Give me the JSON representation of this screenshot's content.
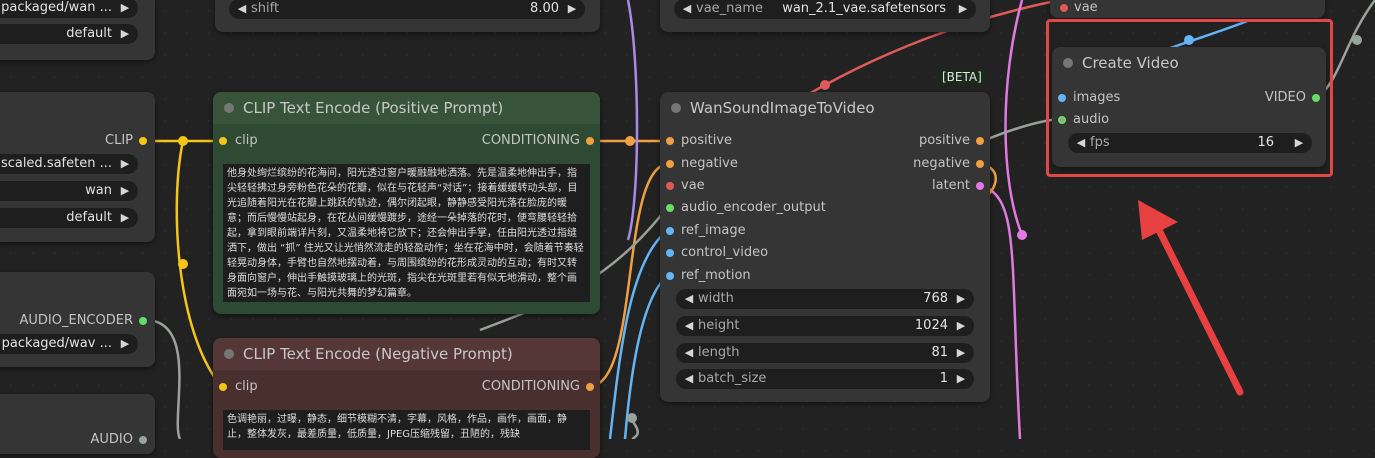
{
  "left_top_node": {
    "widgets": [
      {
        "value": "packaged/wan ..."
      },
      {
        "value": "default"
      }
    ]
  },
  "shift_node": {
    "widget": {
      "label": "shift",
      "value": "8.00"
    }
  },
  "vae_loader": {
    "widget": {
      "label": "vae_name",
      "value": "wan_2.1_vae.safetensors"
    }
  },
  "top_right_node": {
    "input": "vae"
  },
  "clip_loader": {
    "output": "CLIP",
    "widgets": [
      {
        "value": "scaled.safeten ..."
      },
      {
        "value": "wan"
      },
      {
        "value": "default"
      }
    ]
  },
  "audio_encoder_loader": {
    "output": "AUDIO_ENCODER",
    "widgets": [
      {
        "value": "packaged/wav ..."
      }
    ]
  },
  "left_bottom_node": {
    "output": "AUDIO"
  },
  "positive_prompt": {
    "title": "CLIP Text Encode (Positive Prompt)",
    "input": "clip",
    "output": "CONDITIONING",
    "text": "他身处绚烂缤纷的花海间，阳光透过窗户暖融融地洒落。先是温柔地伸出手，指尖轻轻拂过身旁粉色花朵的花瓣，似在与花轻声“对话”；接着缓缓转动头部，目光追随着阳光在花瓣上跳跃的轨迹，偶尔闭起眼，静静感受阳光落在脸庞的暖意；而后慢慢站起身，在花丛间缓慢踱步，途经一朵掉落的花时，便弯腰轻轻拾起，拿到眼前端详片刻，又温柔地将它放下；还会伸出手掌，任由阳光透过指缝洒下，做出 “抓” 住光又让光悄然流走的轻盈动作；坐在花海中时，会随着节奏轻轻晃动身体，手臂也自然地摆动着，与周围缤纷的花形成灵动的互动；有时又转身面向窗户，伸出手触摸玻璃上的光斑，指尖在光斑里若有似无地滑动，整个画面宛如一场与花、与阳光共舞的梦幻篇章。"
  },
  "negative_prompt": {
    "title": "CLIP Text Encode (Negative Prompt)",
    "input": "clip",
    "output": "CONDITIONING",
    "text": "色调艳丽，过曝，静态，细节模糊不清，字幕，风格，作品，画作，画面，静止，整体发灰，最差质量，低质量，JPEG压缩残留，丑陋的，残缺"
  },
  "wan_sound": {
    "badge": "[BETA]",
    "title": "WanSoundImageToVideo",
    "inputs": [
      "positive",
      "negative",
      "vae",
      "audio_encoder_output",
      "ref_image",
      "control_video",
      "ref_motion"
    ],
    "outputs": [
      "positive",
      "negative",
      "latent"
    ],
    "widgets": [
      {
        "label": "width",
        "value": "768"
      },
      {
        "label": "height",
        "value": "1024"
      },
      {
        "label": "length",
        "value": "81"
      },
      {
        "label": "batch_size",
        "value": "1"
      }
    ]
  },
  "create_video": {
    "title": "Create Video",
    "inputs": [
      "images",
      "audio"
    ],
    "output": "VIDEO",
    "widget": {
      "label": "fps",
      "value": "16"
    }
  },
  "colors": {
    "canvas": "#222222",
    "node": "#353535",
    "positive_node": "#2f4a32",
    "negative_node": "#4a2f2f",
    "clip_wire": "#f5c518",
    "conditioning_wire": "#f0a040",
    "vae_wire": "#e05a5a",
    "image_wire": "#64b5f6",
    "highlight": "#e04848"
  },
  "icons": [
    "arrow-left-icon",
    "arrow-right-icon",
    "node-collapse-dot-icon",
    "red-annotation-arrow-icon"
  ]
}
